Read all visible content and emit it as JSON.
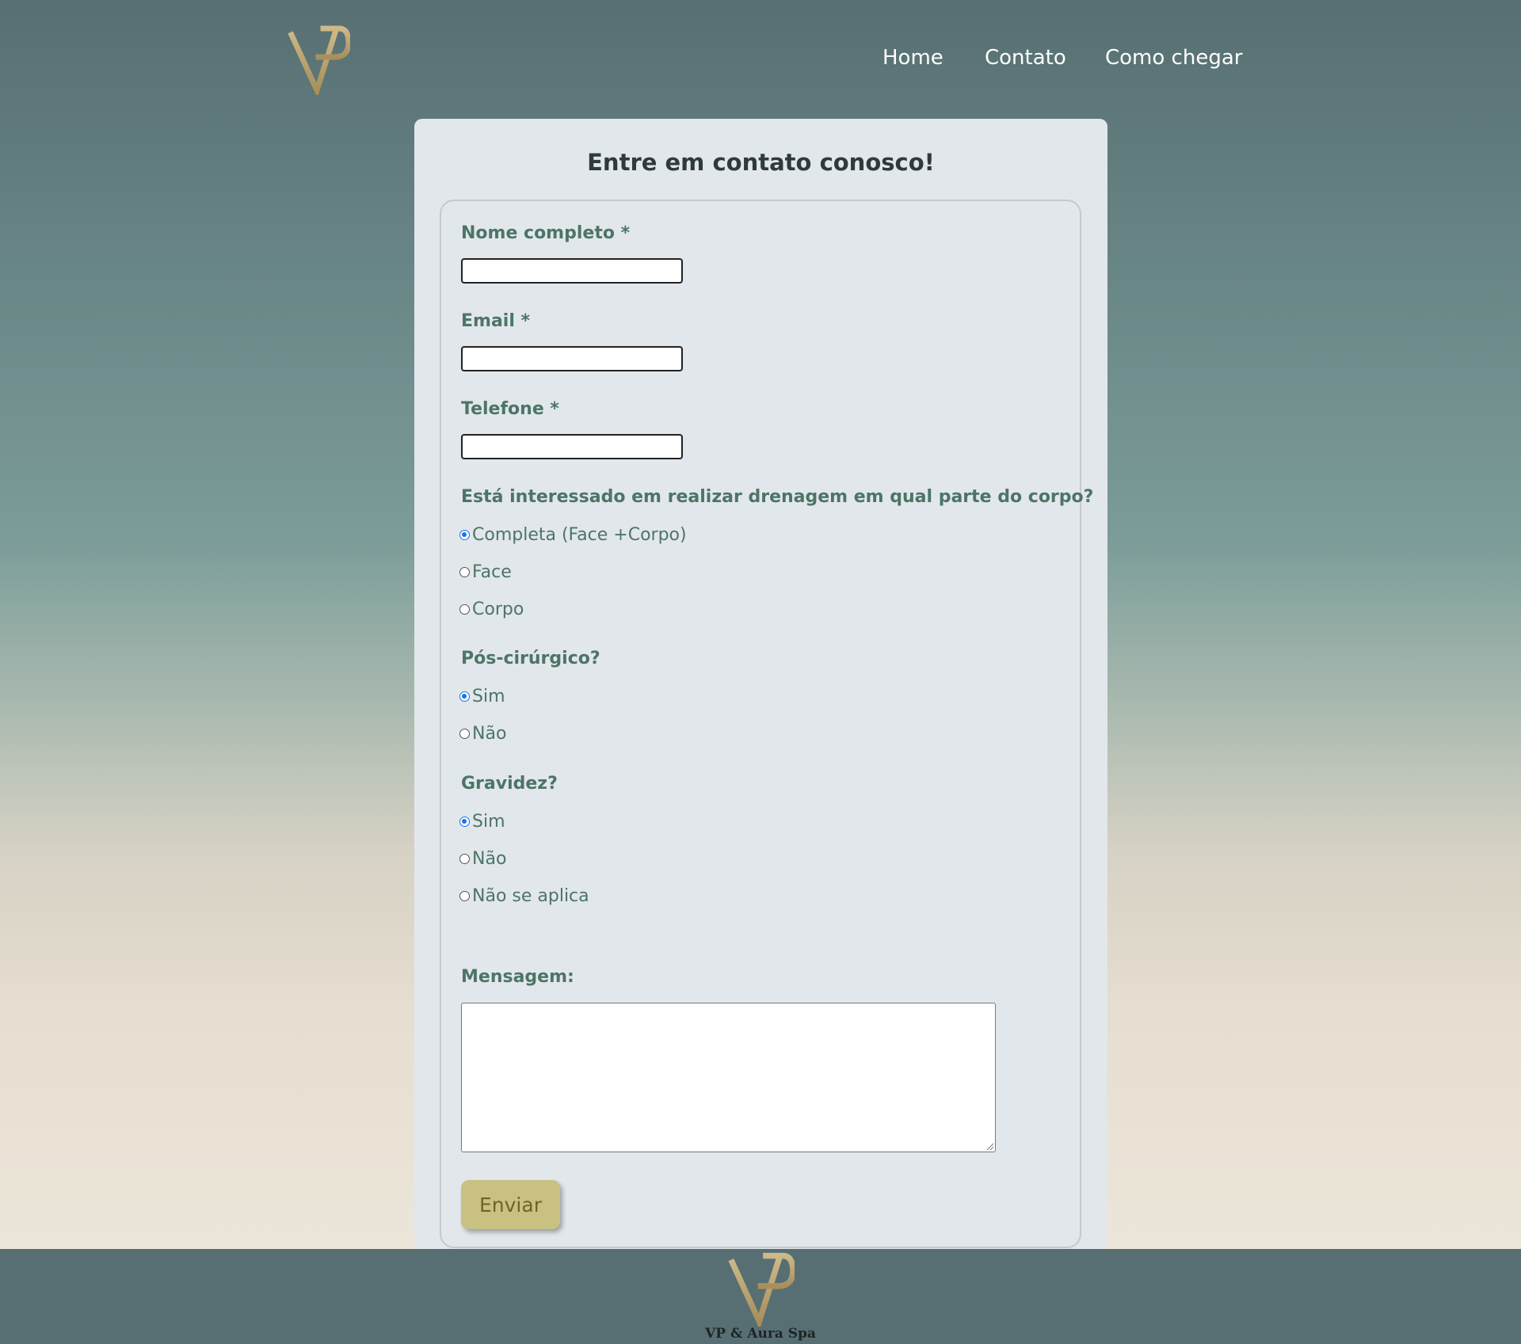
{
  "nav": {
    "logo": "logo-icon",
    "items": [
      {
        "label": "Home"
      },
      {
        "label": "Contato"
      },
      {
        "label": "Como chegar"
      }
    ]
  },
  "form": {
    "title": "Entre em contato conosco!",
    "name_label": "Nome completo *",
    "name_value": "",
    "email_label": "Email *",
    "email_value": "",
    "phone_label": "Telefone *",
    "phone_value": "",
    "drainage": {
      "label": "Está interessado em realizar drenagem em qual parte do corpo?",
      "options": [
        "Completa (Face +Corpo)",
        "Face",
        "Corpo"
      ],
      "selected": "Completa (Face +Corpo)"
    },
    "post_surgical": {
      "label": "Pós-cirúrgico?",
      "options": [
        "Sim",
        "Não"
      ],
      "selected": "Sim"
    },
    "pregnancy": {
      "label": "Gravidez?",
      "options": [
        "Sim",
        "Não",
        "Não se aplica"
      ],
      "selected": "Sim"
    },
    "message_label": "Mensagem:",
    "message_value": "",
    "submit_label": "Enviar"
  },
  "footer": {
    "brand": "VP & Aura Spa"
  },
  "colors": {
    "header_bg": "#576f72",
    "card_bg": "#e1e7eb",
    "label_green": "#4d7567",
    "button_bg": "#c8c181",
    "logo_gold": "#b8a16d"
  }
}
